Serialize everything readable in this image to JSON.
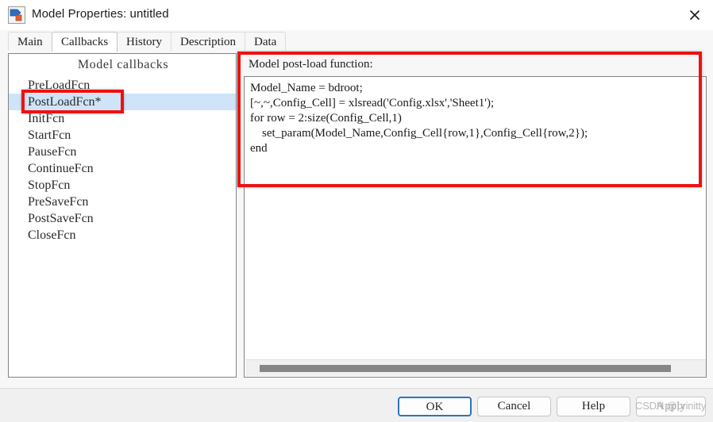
{
  "window": {
    "title": "Model Properties: untitled",
    "icon": "simulink-model-icon",
    "close_icon": "close-icon"
  },
  "tabs": [
    {
      "label": "Main",
      "active": false
    },
    {
      "label": "Callbacks",
      "active": true
    },
    {
      "label": "History",
      "active": false
    },
    {
      "label": "Description",
      "active": false
    },
    {
      "label": "Data",
      "active": false
    }
  ],
  "callbacks_panel": {
    "header": "Model callbacks",
    "items": [
      {
        "label": "PreLoadFcn",
        "selected": false
      },
      {
        "label": "PostLoadFcn*",
        "selected": true
      },
      {
        "label": "InitFcn",
        "selected": false
      },
      {
        "label": "StartFcn",
        "selected": false
      },
      {
        "label": "PauseFcn",
        "selected": false
      },
      {
        "label": "ContinueFcn",
        "selected": false
      },
      {
        "label": "StopFcn",
        "selected": false
      },
      {
        "label": "PreSaveFcn",
        "selected": false
      },
      {
        "label": "PostSaveFcn",
        "selected": false
      },
      {
        "label": "CloseFcn",
        "selected": false
      }
    ]
  },
  "code_panel": {
    "label": "Model post-load function:",
    "code": "Model_Name = bdroot;\n[~,~,Config_Cell] = xlsread('Config.xlsx','Sheet1');\nfor row = 2:size(Config_Cell,1)\n    set_param(Model_Name,Config_Cell{row,1},Config_Cell{row,2});\nend"
  },
  "footer": {
    "ok": "OK",
    "cancel": "Cancel",
    "help": "Help",
    "apply": "Apply"
  },
  "watermark": {
    "text": "CSDN @prinitty"
  },
  "colors": {
    "selection_blue": "#cfe4f8",
    "annotation_red": "#ee1111",
    "default_button_border": "#2a73c0",
    "panel_border": "#828282",
    "scrollbar_thumb": "#868686"
  }
}
